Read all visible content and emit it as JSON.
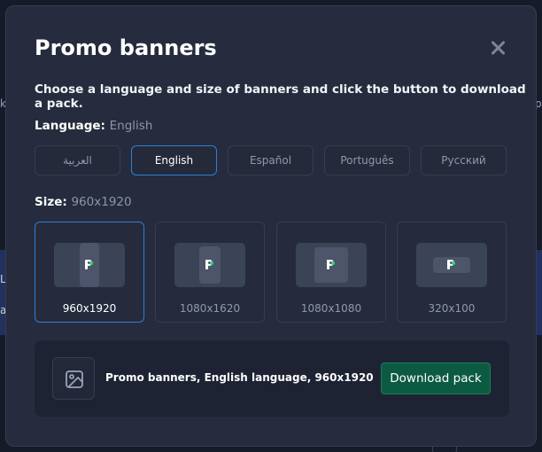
{
  "background": {
    "left_fragment_1": "k",
    "left_fragment_2": "L",
    "left_fragment_3": "a",
    "right_fragment": "p"
  },
  "modal": {
    "title": "Promo banners",
    "subtitle": "Choose a language and size of banners and click the button to download a pack.",
    "language": {
      "label": "Language:",
      "selected": "English",
      "options": [
        "العربية",
        "English",
        "Español",
        "Português",
        "Русский"
      ],
      "active_index": 1
    },
    "size": {
      "label": "Size:",
      "selected": "960x1920",
      "options": [
        "960x1920",
        "1080x1620",
        "1080x1080",
        "320x100"
      ],
      "active_index": 0
    },
    "summary": {
      "text": "Promo banners, English language, 960x1920",
      "download_label": "Download pack"
    }
  },
  "colors": {
    "accent": "#2e7fd4",
    "download_button": "#0d5a42",
    "logo_dot": "#2ed573"
  }
}
